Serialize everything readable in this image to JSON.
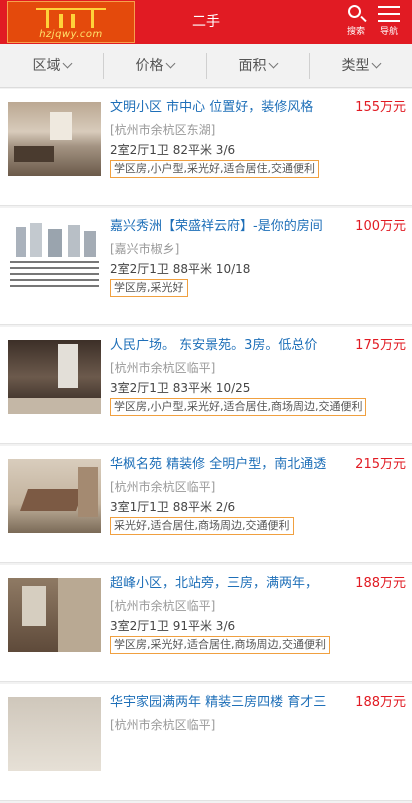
{
  "header": {
    "logo_domain": "hzjqwy.com",
    "title": "二手",
    "search_label": "搜索",
    "nav_label": "导航"
  },
  "filters": [
    {
      "label": "区域"
    },
    {
      "label": "价格"
    },
    {
      "label": "面积"
    },
    {
      "label": "类型"
    }
  ],
  "listings": [
    {
      "title": "文明小区 市中心 位置好，装修风格",
      "price": "155万元",
      "location": "[杭州市余杭区东湖]",
      "spec": "2室2厅1卫 82平米 3/6",
      "tags": "学区房,小户型,采光好,适合居住,交通便利"
    },
    {
      "title": "嘉兴秀洲【荣盛祥云府】-是你的房间",
      "price": "100万元",
      "location": "[嘉兴市椒乡]",
      "spec": "2室2厅1卫 88平米 10/18",
      "tags": "学区房,采光好"
    },
    {
      "title": "人民广场。 东安景苑。3房。低总价",
      "price": "175万元",
      "location": "[杭州市余杭区临平]",
      "spec": "3室2厅1卫 83平米 10/25",
      "tags": "学区房,小户型,采光好,适合居住,商场周边,交通便利"
    },
    {
      "title": "华枫名苑 精装修 全明户型，南北通透",
      "price": "215万元",
      "location": "[杭州市余杭区临平]",
      "spec": "3室1厅1卫 88平米 2/6",
      "tags": "采光好,适合居住,商场周边,交通便利"
    },
    {
      "title": "超峰小区，北站旁，三房，满两年，",
      "price": "188万元",
      "location": "[杭州市余杭区临平]",
      "spec": "3室2厅1卫 91平米 3/6",
      "tags": "学区房,采光好,适合居住,商场周边,交通便利"
    },
    {
      "title": "华宇家园满两年 精装三房四楼 育才三",
      "price": "188万元",
      "location": "[杭州市余杭区临平]",
      "spec": "",
      "tags": ""
    }
  ],
  "colors": {
    "brand_red": "#e11b23",
    "link_blue": "#1e6fb8",
    "tag_border": "#f0a040"
  }
}
